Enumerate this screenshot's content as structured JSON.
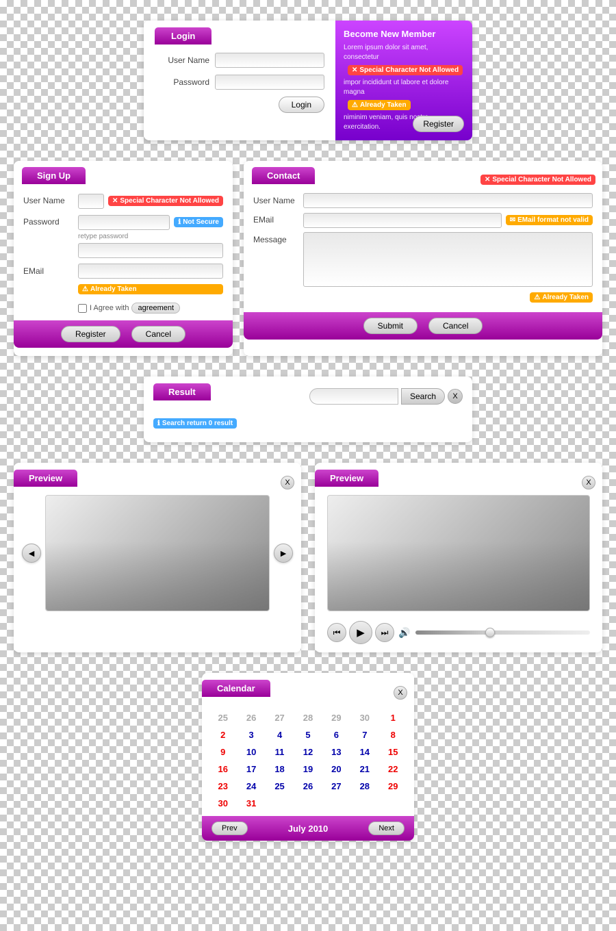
{
  "login": {
    "tab_label": "Login",
    "username_label": "User Name",
    "password_label": "Password",
    "login_btn": "Login",
    "register_btn": "Register",
    "become_member": {
      "title": "Become New Member",
      "body": "Lorem ipsum dolor sit amet, consectetur",
      "badge_error": "Special Character Not Allowed",
      "body2": "impor incididunt ut labore et dolore magna",
      "badge_warning": "Already Taken",
      "body3": "niminim veniam, quis nostro exercitation."
    }
  },
  "signup": {
    "tab_label": "Sign Up",
    "username_label": "User Name",
    "password_label": "Password",
    "retype_hint": "retype password",
    "email_label": "EMail",
    "agree_label": "I Agree with",
    "agreement_link": "agreement",
    "register_btn": "Register",
    "cancel_btn": "Cancel",
    "badge_special": "Special Character Not Allowed",
    "badge_not_secure": "Not Secure",
    "badge_already": "Already Taken"
  },
  "contact": {
    "tab_label": "Contact",
    "name_label": "User Name",
    "email_label": "EMail",
    "message_label": "Message",
    "submit_btn": "Submit",
    "cancel_btn": "Cancel",
    "badge_special_name": "Special Character Not Allowed",
    "badge_email_invalid": "EMail format not valid",
    "badge_already": "Already Taken"
  },
  "result": {
    "tab_label": "Result",
    "search_placeholder": "",
    "search_btn": "Search",
    "search_clear": "X",
    "no_result_badge": "Search return 0 result"
  },
  "preview1": {
    "tab_label": "Preview",
    "close_btn": "X",
    "prev_btn": "◄",
    "next_btn": "►"
  },
  "preview2": {
    "tab_label": "Preview",
    "close_btn": "X",
    "rewind_btn": "⏮",
    "play_btn": "▶",
    "forward_btn": "⏭",
    "volume_icon": "🔊"
  },
  "calendar": {
    "tab_label": "Calendar",
    "close_btn": "X",
    "month_label": "July 2010",
    "prev_btn": "Prev",
    "next_btn": "Next",
    "weeks": [
      [
        "25",
        "26",
        "27",
        "28",
        "29",
        "30",
        "1"
      ],
      [
        "2",
        "3",
        "4",
        "5",
        "6",
        "7",
        "8"
      ],
      [
        "9",
        "10",
        "11",
        "12",
        "13",
        "14",
        "15"
      ],
      [
        "16",
        "17",
        "18",
        "19",
        "20",
        "21",
        "22"
      ],
      [
        "23",
        "24",
        "25",
        "26",
        "27",
        "28",
        "29"
      ],
      [
        "30",
        "31",
        "",
        "",
        "",
        "",
        ""
      ]
    ],
    "week_types": [
      [
        "gray",
        "gray",
        "gray",
        "gray",
        "gray",
        "gray",
        "red"
      ],
      [
        "red",
        "blue",
        "blue",
        "blue",
        "blue",
        "blue",
        "red"
      ],
      [
        "red",
        "blue",
        "blue",
        "blue",
        "blue",
        "blue",
        "red"
      ],
      [
        "red",
        "blue",
        "blue",
        "blue",
        "blue",
        "blue",
        "red"
      ],
      [
        "red",
        "blue",
        "blue",
        "blue",
        "blue",
        "blue",
        "red"
      ],
      [
        "red",
        "red",
        "",
        "",
        "",
        "",
        ""
      ]
    ]
  }
}
